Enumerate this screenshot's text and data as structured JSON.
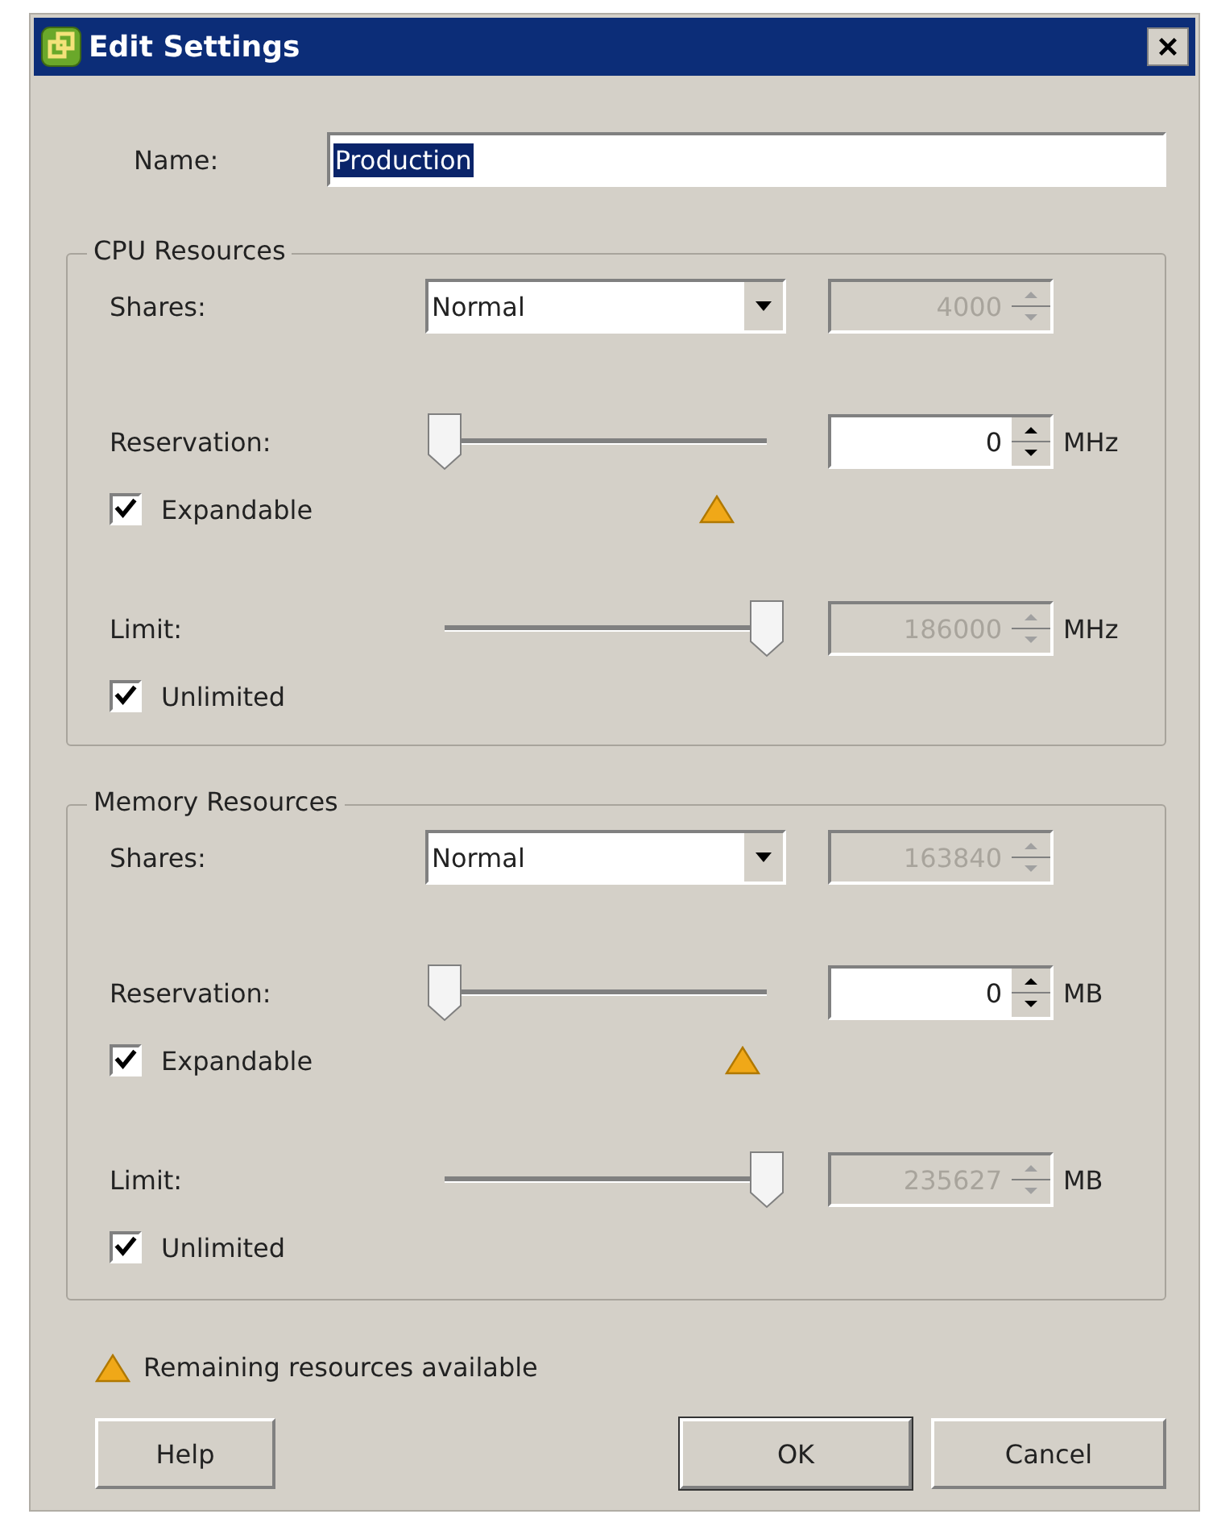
{
  "window": {
    "title": "Edit Settings"
  },
  "name": {
    "label": "Name:",
    "value": "Production",
    "selected": true
  },
  "groups": [
    {
      "title": "CPU Resources",
      "shares": {
        "label": "Shares:",
        "option": "Normal",
        "value": "4000",
        "disabled": true
      },
      "reservation": {
        "label": "Reservation:",
        "level": 0,
        "value": "0",
        "unit": "MHz",
        "disabled": false,
        "warning": true
      },
      "expandable": {
        "label": "Expandable",
        "checked": true
      },
      "limit": {
        "label": "Limit:",
        "level": 1,
        "value": "186000",
        "unit": "MHz",
        "disabled": true
      },
      "unlimited": {
        "label": "Unlimited",
        "checked": true
      }
    },
    {
      "title": "Memory Resources",
      "shares": {
        "label": "Shares:",
        "option": "Normal",
        "value": "163840",
        "disabled": true
      },
      "reservation": {
        "label": "Reservation:",
        "level": 0,
        "value": "0",
        "unit": "MB",
        "disabled": false,
        "warning": true
      },
      "expandable": {
        "label": "Expandable",
        "checked": true
      },
      "limit": {
        "label": "Limit:",
        "level": 1,
        "value": "235627",
        "unit": "MB",
        "disabled": true
      },
      "unlimited": {
        "label": "Unlimited",
        "checked": true
      }
    }
  ],
  "legend": {
    "text": "Remaining resources available"
  },
  "buttons": [
    {
      "label": "Help",
      "default": false
    },
    {
      "label": "OK",
      "default": true
    },
    {
      "label": "Cancel",
      "default": false
    }
  ]
}
